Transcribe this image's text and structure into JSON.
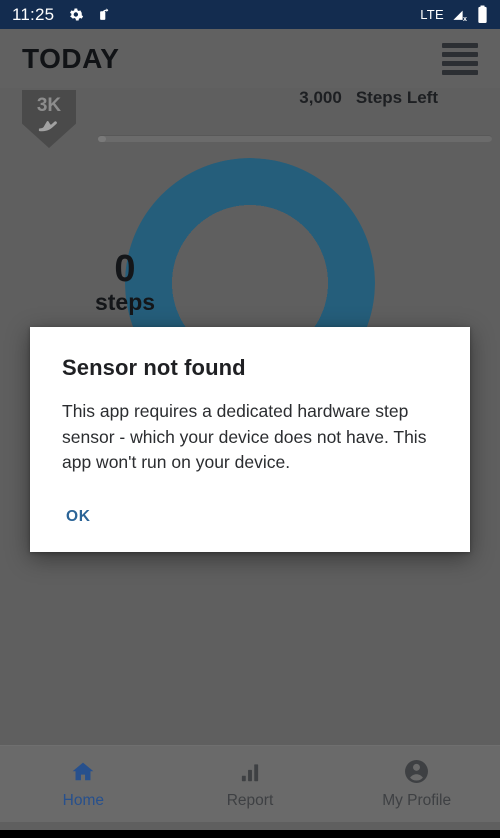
{
  "statusbar": {
    "clock": "11:25",
    "network_label": "LTE",
    "icons": [
      "gear-icon",
      "screen-rotation-icon",
      "signal-no-service-icon",
      "battery-icon"
    ]
  },
  "appbar": {
    "title": "TODAY",
    "menu_icon": "hamburger-menu-icon"
  },
  "goal": {
    "badge_label": "3K",
    "badge_glyph": "shoe-icon",
    "steps_left_value": "3,000",
    "steps_left_label": "Steps Left",
    "progress_percent": 0
  },
  "ring": {
    "count": "0",
    "unit": "steps",
    "ring_color": "#255e7b",
    "progress_percent": 100
  },
  "dialog": {
    "title": "Sensor not found",
    "message": "This app requires a dedicated hardware step sensor - which your device does not have. This app won't run on your device.",
    "ok_label": "OK",
    "accent_color": "#2b6497"
  },
  "bottomnav": {
    "active_color": "#27508d",
    "inactive_color": "#3e4043",
    "items": [
      {
        "label": "Home",
        "icon": "home-icon",
        "active": true
      },
      {
        "label": "Report",
        "icon": "bar-chart-icon",
        "active": false
      },
      {
        "label": "My Profile",
        "icon": "account-circle-icon",
        "active": false
      }
    ]
  }
}
